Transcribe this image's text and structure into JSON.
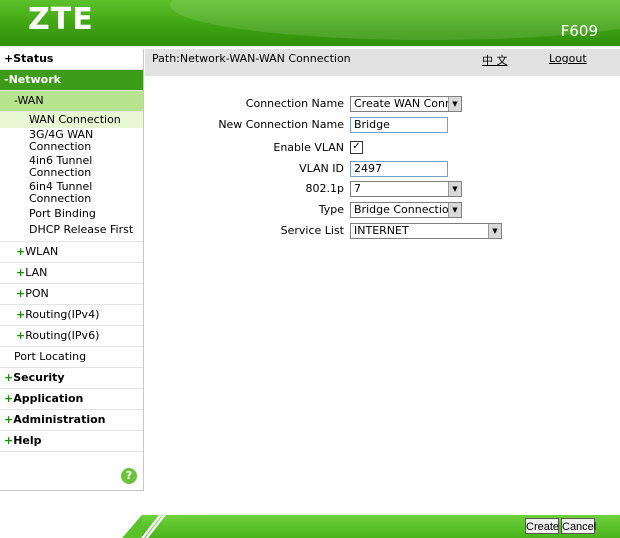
{
  "header": {
    "logo": "ZTE",
    "model": "F609"
  },
  "path": {
    "text": "Path:Network-WAN-WAN Connection",
    "lang": "中 文",
    "logout": "Logout"
  },
  "sidebar": {
    "status": "Status",
    "network": "Network",
    "wan": "WAN",
    "wan_items": [
      "WAN Connection",
      "3G/4G WAN Connection",
      "4in6 Tunnel Connection",
      "6in4 Tunnel Connection",
      "Port Binding",
      "DHCP Release First"
    ],
    "network_items": [
      "WLAN",
      "LAN",
      "PON",
      "Routing(IPv4)",
      "Routing(IPv6)"
    ],
    "port_locating": "Port Locating",
    "security": "Security",
    "application": "Application",
    "administration": "Administration",
    "help": "Help",
    "help_icon": "?"
  },
  "form": {
    "connection_name": {
      "label": "Connection Name",
      "value": "Create WAN Conn"
    },
    "new_connection_name": {
      "label": "New Connection Name",
      "value": "Bridge"
    },
    "enable_vlan": {
      "label": "Enable VLAN",
      "checked": true,
      "mark": "✓"
    },
    "vlan_id": {
      "label": "VLAN ID",
      "value": "2497"
    },
    "p8021": {
      "label": "802.1p",
      "value": "7"
    },
    "type": {
      "label": "Type",
      "value": "Bridge Connection"
    },
    "service_list": {
      "label": "Service List",
      "value": "INTERNET"
    }
  },
  "footer": {
    "create": "Create",
    "cancel": "Cancel"
  },
  "icons": {
    "select_arrow": "▼",
    "plus": "+",
    "minus": "-"
  },
  "colors": {
    "brand_green": "#3c9b17",
    "wan_bg": "#b8e38f",
    "path_bg": "#e2e2e2"
  }
}
